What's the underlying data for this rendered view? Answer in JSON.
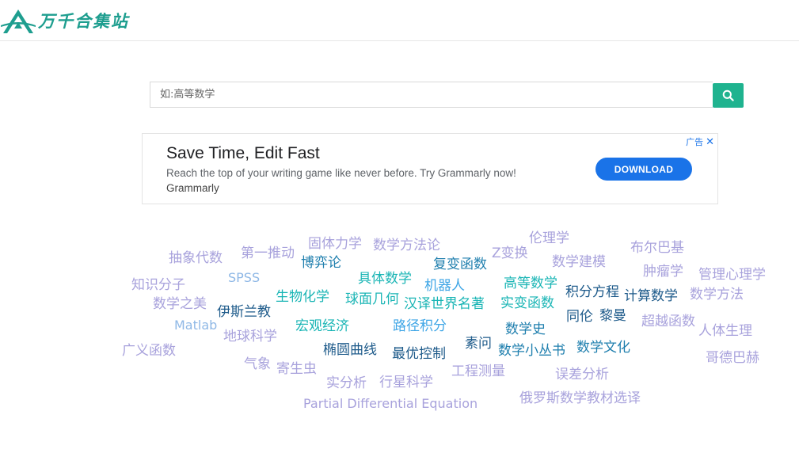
{
  "header": {
    "logo_text": "万千合集站"
  },
  "search": {
    "placeholder": "如:高等数学",
    "button_icon": "search-icon"
  },
  "ad": {
    "title": "Save Time, Edit Fast",
    "description": "Reach the top of your writing game like never before. Try Grammarly now!",
    "brand": "Grammarly",
    "cta_label": "DOWNLOAD",
    "ad_label": "广告",
    "close_icon": "close-icon"
  },
  "tag_cloud": [
    {
      "label": "抽象代数"
    },
    {
      "label": "第一推动"
    },
    {
      "label": "固体力学"
    },
    {
      "label": "数学方法论"
    },
    {
      "label": "伦理学"
    },
    {
      "label": "布尔巴基"
    },
    {
      "label": "博弈论"
    },
    {
      "label": "复变函数"
    },
    {
      "label": "Z变换"
    },
    {
      "label": "数学建模"
    },
    {
      "label": "肿瘤学"
    },
    {
      "label": "管理心理学"
    },
    {
      "label": "知识分子"
    },
    {
      "label": "SPSS"
    },
    {
      "label": "具体数学"
    },
    {
      "label": "机器人"
    },
    {
      "label": "高等数学"
    },
    {
      "label": "积分方程"
    },
    {
      "label": "计算数学"
    },
    {
      "label": "数学方法"
    },
    {
      "label": "数学之美"
    },
    {
      "label": "伊斯兰教"
    },
    {
      "label": "生物化学"
    },
    {
      "label": "球面几何"
    },
    {
      "label": "汉译世界名著"
    },
    {
      "label": "实变函数"
    },
    {
      "label": "同伦"
    },
    {
      "label": "黎曼"
    },
    {
      "label": "超越函数"
    },
    {
      "label": "Matlab"
    },
    {
      "label": "宏观经济"
    },
    {
      "label": "路径积分"
    },
    {
      "label": "数学史"
    },
    {
      "label": "人体生理"
    },
    {
      "label": "地球科学"
    },
    {
      "label": "广义函数"
    },
    {
      "label": "椭圆曲线"
    },
    {
      "label": "最优控制"
    },
    {
      "label": "素问"
    },
    {
      "label": "数学小丛书"
    },
    {
      "label": "数学文化"
    },
    {
      "label": "哥德巴赫"
    },
    {
      "label": "气象"
    },
    {
      "label": "寄生虫"
    },
    {
      "label": "工程测量"
    },
    {
      "label": "误差分析"
    },
    {
      "label": "实分析"
    },
    {
      "label": "行星科学"
    },
    {
      "label": "俄罗斯数学教材选译"
    },
    {
      "label": "Partial Differential Equation"
    }
  ]
}
